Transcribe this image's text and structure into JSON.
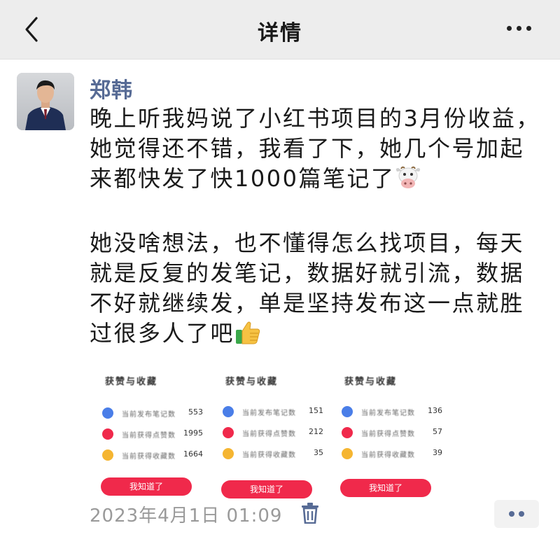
{
  "nav": {
    "title": "详情"
  },
  "post": {
    "author": "郑韩",
    "paragraph1": "晚上听我妈说了小红书项目的3月份收益，她觉得还不错，我看了下，她几个号加起来都快发了快1000篇笔记了",
    "paragraph2": "她没啥想法，也不懂得怎么找项目，每天就是反复的发笔记，数据好就引流，数据不好就继续发，单是坚持发布这一点就胜过很多人了吧",
    "emoji1": "cow-face-emoji",
    "emoji2": "thumbs-up-emoji"
  },
  "screenshots": [
    {
      "heading": "获赞与收藏",
      "rows": [
        {
          "label": "当前发布笔记数",
          "value": "553",
          "icon": "note-icon",
          "color": "#4a7ee8"
        },
        {
          "label": "当前获得点赞数",
          "value": "1995",
          "icon": "heart-icon",
          "color": "#f0294b"
        },
        {
          "label": "当前获得收藏数",
          "value": "1664",
          "icon": "star-icon",
          "color": "#f5b531"
        }
      ],
      "button": "我知道了"
    },
    {
      "heading": "获赞与收藏",
      "rows": [
        {
          "label": "当前发布笔记数",
          "value": "151",
          "icon": "note-icon",
          "color": "#4a7ee8"
        },
        {
          "label": "当前获得点赞数",
          "value": "212",
          "icon": "heart-icon",
          "color": "#f0294b"
        },
        {
          "label": "当前获得收藏数",
          "value": "35",
          "icon": "star-icon",
          "color": "#f5b531"
        }
      ],
      "button": "我知道了"
    },
    {
      "heading": "获赞与收藏",
      "rows": [
        {
          "label": "当前发布笔记数",
          "value": "136",
          "icon": "note-icon",
          "color": "#4a7ee8"
        },
        {
          "label": "当前获得点赞数",
          "value": "57",
          "icon": "heart-icon",
          "color": "#f0294b"
        },
        {
          "label": "当前获得收藏数",
          "value": "39",
          "icon": "star-icon",
          "color": "#f5b531"
        }
      ],
      "button": "我知道了"
    }
  ],
  "footer": {
    "timestamp": "2023年4月1日 01:09"
  },
  "colors": {
    "link": "#576b95",
    "accent_red": "#f0294b",
    "nav_bg": "#ededed"
  }
}
